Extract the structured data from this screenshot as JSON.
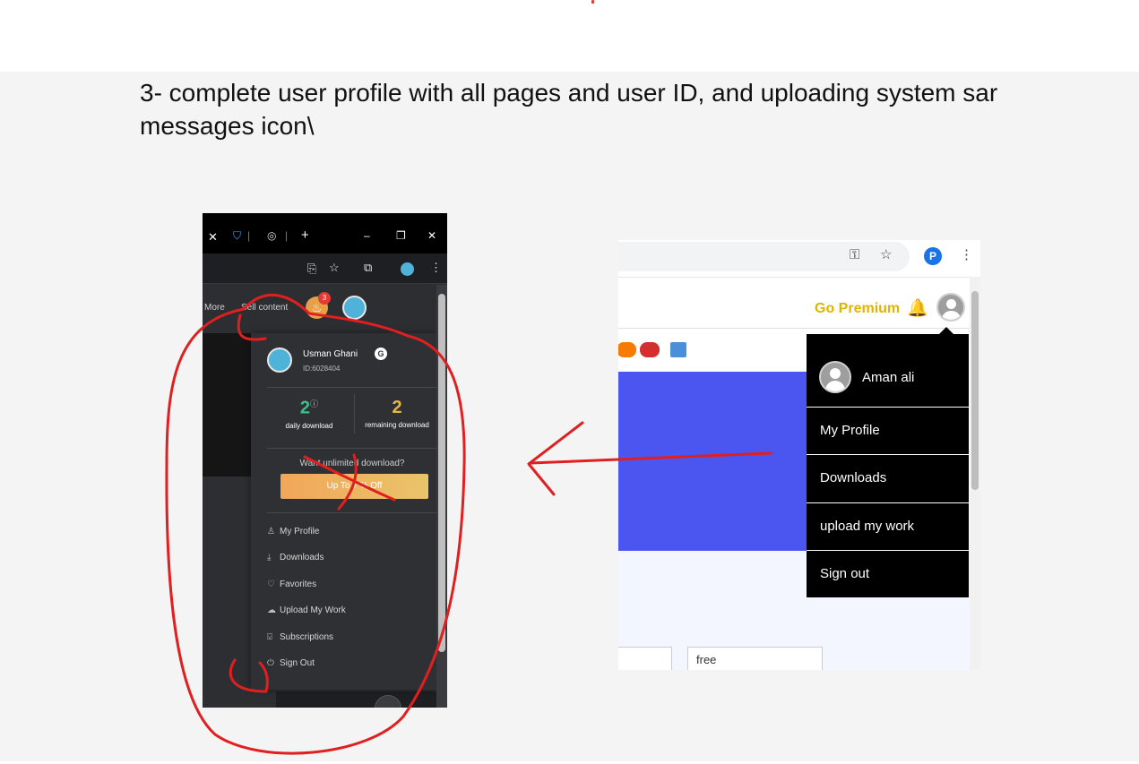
{
  "note": {
    "line1": "3- complete user profile with all pages and user ID, and uploading system sar",
    "line2": "messages icon\\"
  },
  "left_screenshot": {
    "nav_more": "More",
    "nav_sell": "Sell content",
    "notification_count": "3",
    "user": {
      "name": "Usman Ghani",
      "id": "ID:6028404",
      "provider": "G"
    },
    "stats": [
      {
        "value": "2",
        "label": "daily download",
        "color": "#3dbf8a"
      },
      {
        "value": "2",
        "label": "remaining download",
        "color": "#e9b44c"
      }
    ],
    "want_text": "Want unlimited download?",
    "upgrade_button": "Up To 7 % Off",
    "menu": [
      {
        "icon": "user-icon",
        "label": "My Profile"
      },
      {
        "icon": "download-icon",
        "label": "Downloads"
      },
      {
        "icon": "heart-icon",
        "label": "Favorites"
      },
      {
        "icon": "cloud-upload-icon",
        "label": "Upload My Work"
      },
      {
        "icon": "bookmark-icon",
        "label": "Subscriptions"
      },
      {
        "icon": "power-icon",
        "label": "Sign Out"
      }
    ]
  },
  "right_screenshot": {
    "go_premium": "Go Premium",
    "user_name": "Aman ali",
    "menu": [
      "My Profile",
      "Downloads",
      "upload my work",
      "Sign out"
    ],
    "free_label": "free",
    "accent": "#4b55f0",
    "premium_color": "#e0b400"
  },
  "annotation_color": "#e02020"
}
